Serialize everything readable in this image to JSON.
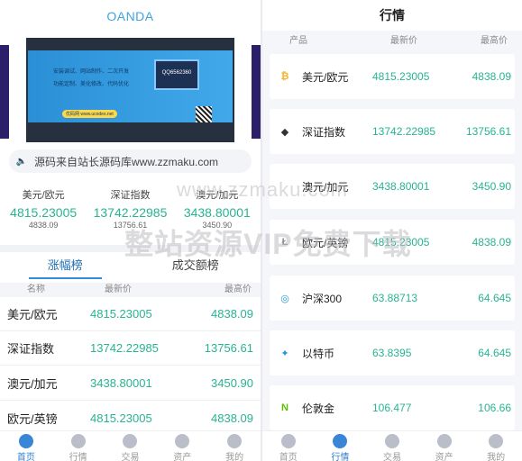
{
  "left": {
    "brand": "OANDA",
    "banner": {
      "line1": "安装调试、网站制作、二次开发",
      "line2": "功能定制、美化修改、代码优化",
      "link": "优码网 www.ucodes.net",
      "monitor_text": "QQ6562360"
    },
    "notice": "源码来自站长源码库www.zzmaku.com",
    "cards": [
      {
        "name": "美元/欧元",
        "price": "4815.23005",
        "high": "4838.09"
      },
      {
        "name": "深证指数",
        "price": "13742.22985",
        "high": "13756.61"
      },
      {
        "name": "澳元/加元",
        "price": "3438.80001",
        "high": "3450.90"
      }
    ],
    "tabs": [
      "涨幅榜",
      "成交额榜"
    ],
    "columns": [
      "名称",
      "最新价",
      "最高价"
    ],
    "rows": [
      {
        "name": "美元/欧元",
        "price": "4815.23005",
        "high": "4838.09"
      },
      {
        "name": "深证指数",
        "price": "13742.22985",
        "high": "13756.61"
      },
      {
        "name": "澳元/加元",
        "price": "3438.80001",
        "high": "3450.90"
      },
      {
        "name": "欧元/英镑",
        "price": "4815.23005",
        "high": "4838.09"
      }
    ]
  },
  "nav": [
    "首页",
    "行情",
    "交易",
    "资产",
    "我的"
  ],
  "right": {
    "title": "行情",
    "columns": [
      "产品",
      "最新价",
      "最高价"
    ],
    "rows": [
      {
        "name": "美元/欧元",
        "price": "4815.23005",
        "high": "4838.09",
        "icon": "bitcoin-icon",
        "glyph": "₿",
        "color": "#f7b32b"
      },
      {
        "name": "深证指数",
        "price": "13742.22985",
        "high": "13756.61",
        "icon": "ethereum-icon",
        "glyph": "◆",
        "color": "#333333"
      },
      {
        "name": "澳元/加元",
        "price": "3438.80001",
        "high": "3450.90",
        "icon": "coin-icon",
        "glyph": "",
        "color": "#ffffff"
      },
      {
        "name": "欧元/英镑",
        "price": "4815.23005",
        "high": "4838.09",
        "icon": "litecoin-icon",
        "glyph": "Ł",
        "color": "#8c8c8c"
      },
      {
        "name": "沪深300",
        "price": "63.88713",
        "high": "64.645",
        "icon": "globe-icon",
        "glyph": "◎",
        "color": "#2a95d6"
      },
      {
        "name": "以特币",
        "price": "63.8395",
        "high": "64.645",
        "icon": "ripple-icon",
        "glyph": "✦",
        "color": "#2a95d6"
      },
      {
        "name": "伦敦金",
        "price": "106.477",
        "high": "106.66",
        "icon": "neo-icon",
        "glyph": "N",
        "color": "#58bf00"
      }
    ]
  },
  "watermark": {
    "line1": "www.zzmaku.com",
    "line2": "整站资源VIP免费下载"
  }
}
